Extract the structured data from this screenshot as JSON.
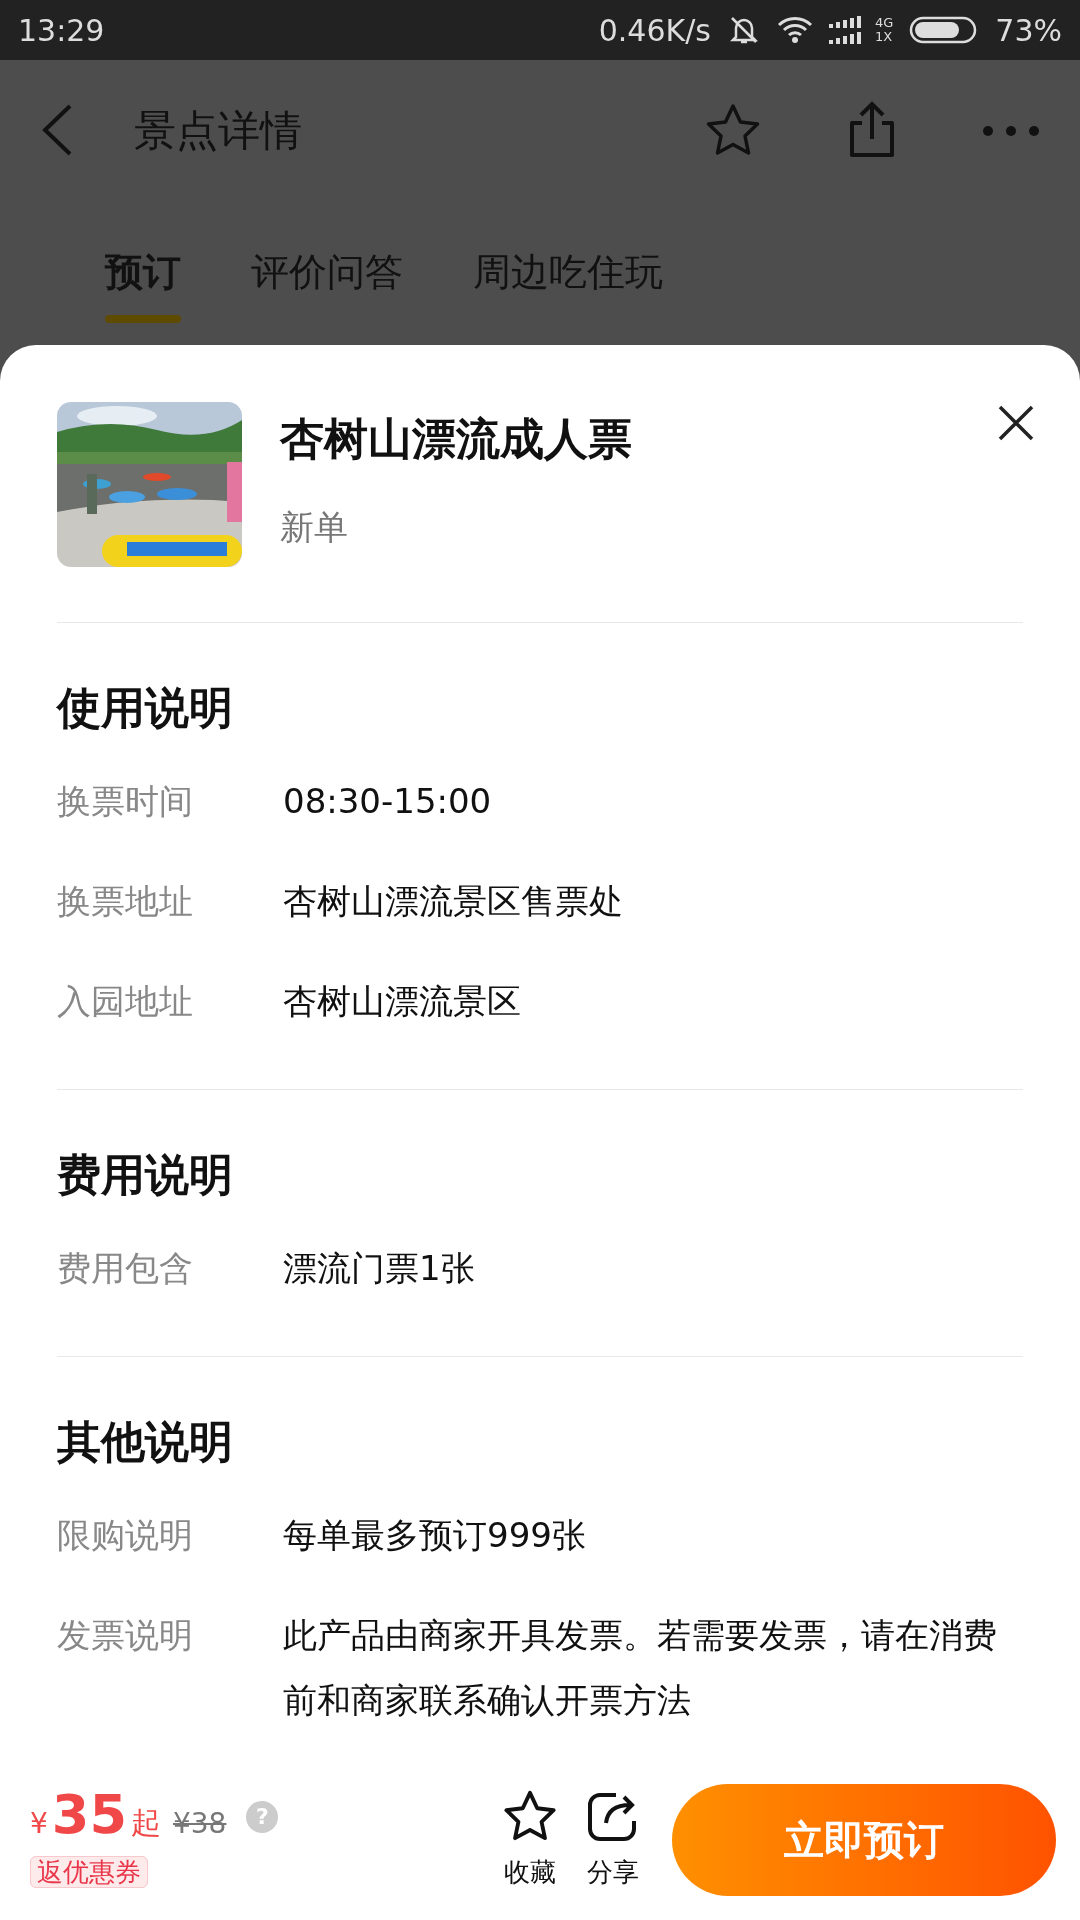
{
  "status_bar": {
    "time": "13:29",
    "speed": "0.46K/s",
    "network_top": "4G",
    "network_bottom": "1X",
    "battery": "73%"
  },
  "header": {
    "title": "景点详情"
  },
  "tabs": [
    {
      "label": "预订",
      "selected": true
    },
    {
      "label": "评价问答",
      "selected": false
    },
    {
      "label": "周边吃住玩",
      "selected": false
    }
  ],
  "product": {
    "title": "杏树山漂流成人票",
    "subtitle": "新单"
  },
  "sections": [
    {
      "heading": "使用说明",
      "rows": [
        {
          "label": "换票时间",
          "value": "08:30-15:00"
        },
        {
          "label": "换票地址",
          "value": "杏树山漂流景区售票处"
        },
        {
          "label": "入园地址",
          "value": "杏树山漂流景区"
        }
      ]
    },
    {
      "heading": "费用说明",
      "rows": [
        {
          "label": "费用包含",
          "value": "漂流门票1张"
        }
      ]
    },
    {
      "heading": "其他说明",
      "rows": [
        {
          "label": "限购说明",
          "value": "每单最多预订999张"
        },
        {
          "label": "发票说明",
          "value": "此产品由商家开具发票。若需要发票，请在消费前和商家联系确认开票方法"
        }
      ]
    }
  ],
  "bottom_bar": {
    "currency": "¥",
    "price": "35",
    "price_suffix": "起",
    "original_price": "¥38",
    "help": "?",
    "coupon": "返优惠券",
    "actions": [
      {
        "kind": "favorite",
        "label": "收藏"
      },
      {
        "kind": "share",
        "label": "分享"
      }
    ],
    "book_button": "立即预订"
  }
}
